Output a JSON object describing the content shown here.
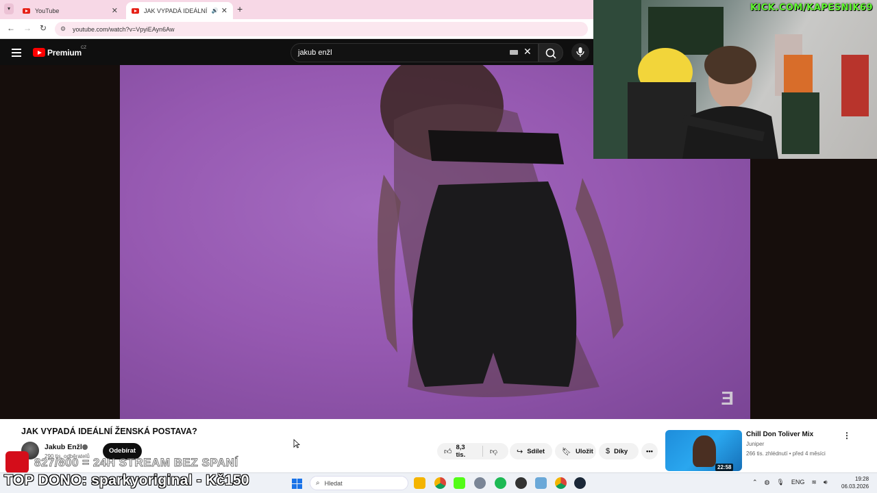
{
  "browser": {
    "tabs": [
      {
        "title": "YouTube",
        "active": false
      },
      {
        "title": "JAK VYPADÁ IDEÁLNÍ ŽENSKÁ",
        "active": true
      }
    ],
    "url": "youtube.com/watch?v=VpyiEAyn6Aw"
  },
  "youtube": {
    "logo": "Premium",
    "region": "CZ",
    "search_value": "jakub enžl"
  },
  "overlay": {
    "kick_url": "KICK.COM/KAPESNIK69",
    "goal_text": "827/800 = 24H STREAM BEZ SPANÍ",
    "top_dono": "TOP DONO: sparkyoriginal - Kč150"
  },
  "video": {
    "title": "JAK VYPADÁ IDEÁLNÍ ŽENSKÁ POSTAVA?",
    "channel": "Jakub Enžl",
    "subscribers": "290 tis. odběratelů",
    "subscribe_label": "Odebírat",
    "likes": "8,3 tis.",
    "share_label": "Sdílet",
    "save_label": "Uložit",
    "thanks_label": "Díky",
    "more_label": "•••"
  },
  "recommendation": {
    "title": "Chill Don Toliver Mix",
    "channel": "Juniper",
    "meta": "266 tis. zhlédnutí • před 4 měsíci",
    "duration": "22:58"
  },
  "taskbar": {
    "search_placeholder": "Hledat",
    "language": "ENG",
    "time": "19:28",
    "date": "06.03.2026"
  },
  "colors": {
    "tab_bar": "#f7d8e6",
    "yt_red": "#ff0000",
    "video_bg": "#9659b1",
    "kick_green": "#5ff530"
  }
}
